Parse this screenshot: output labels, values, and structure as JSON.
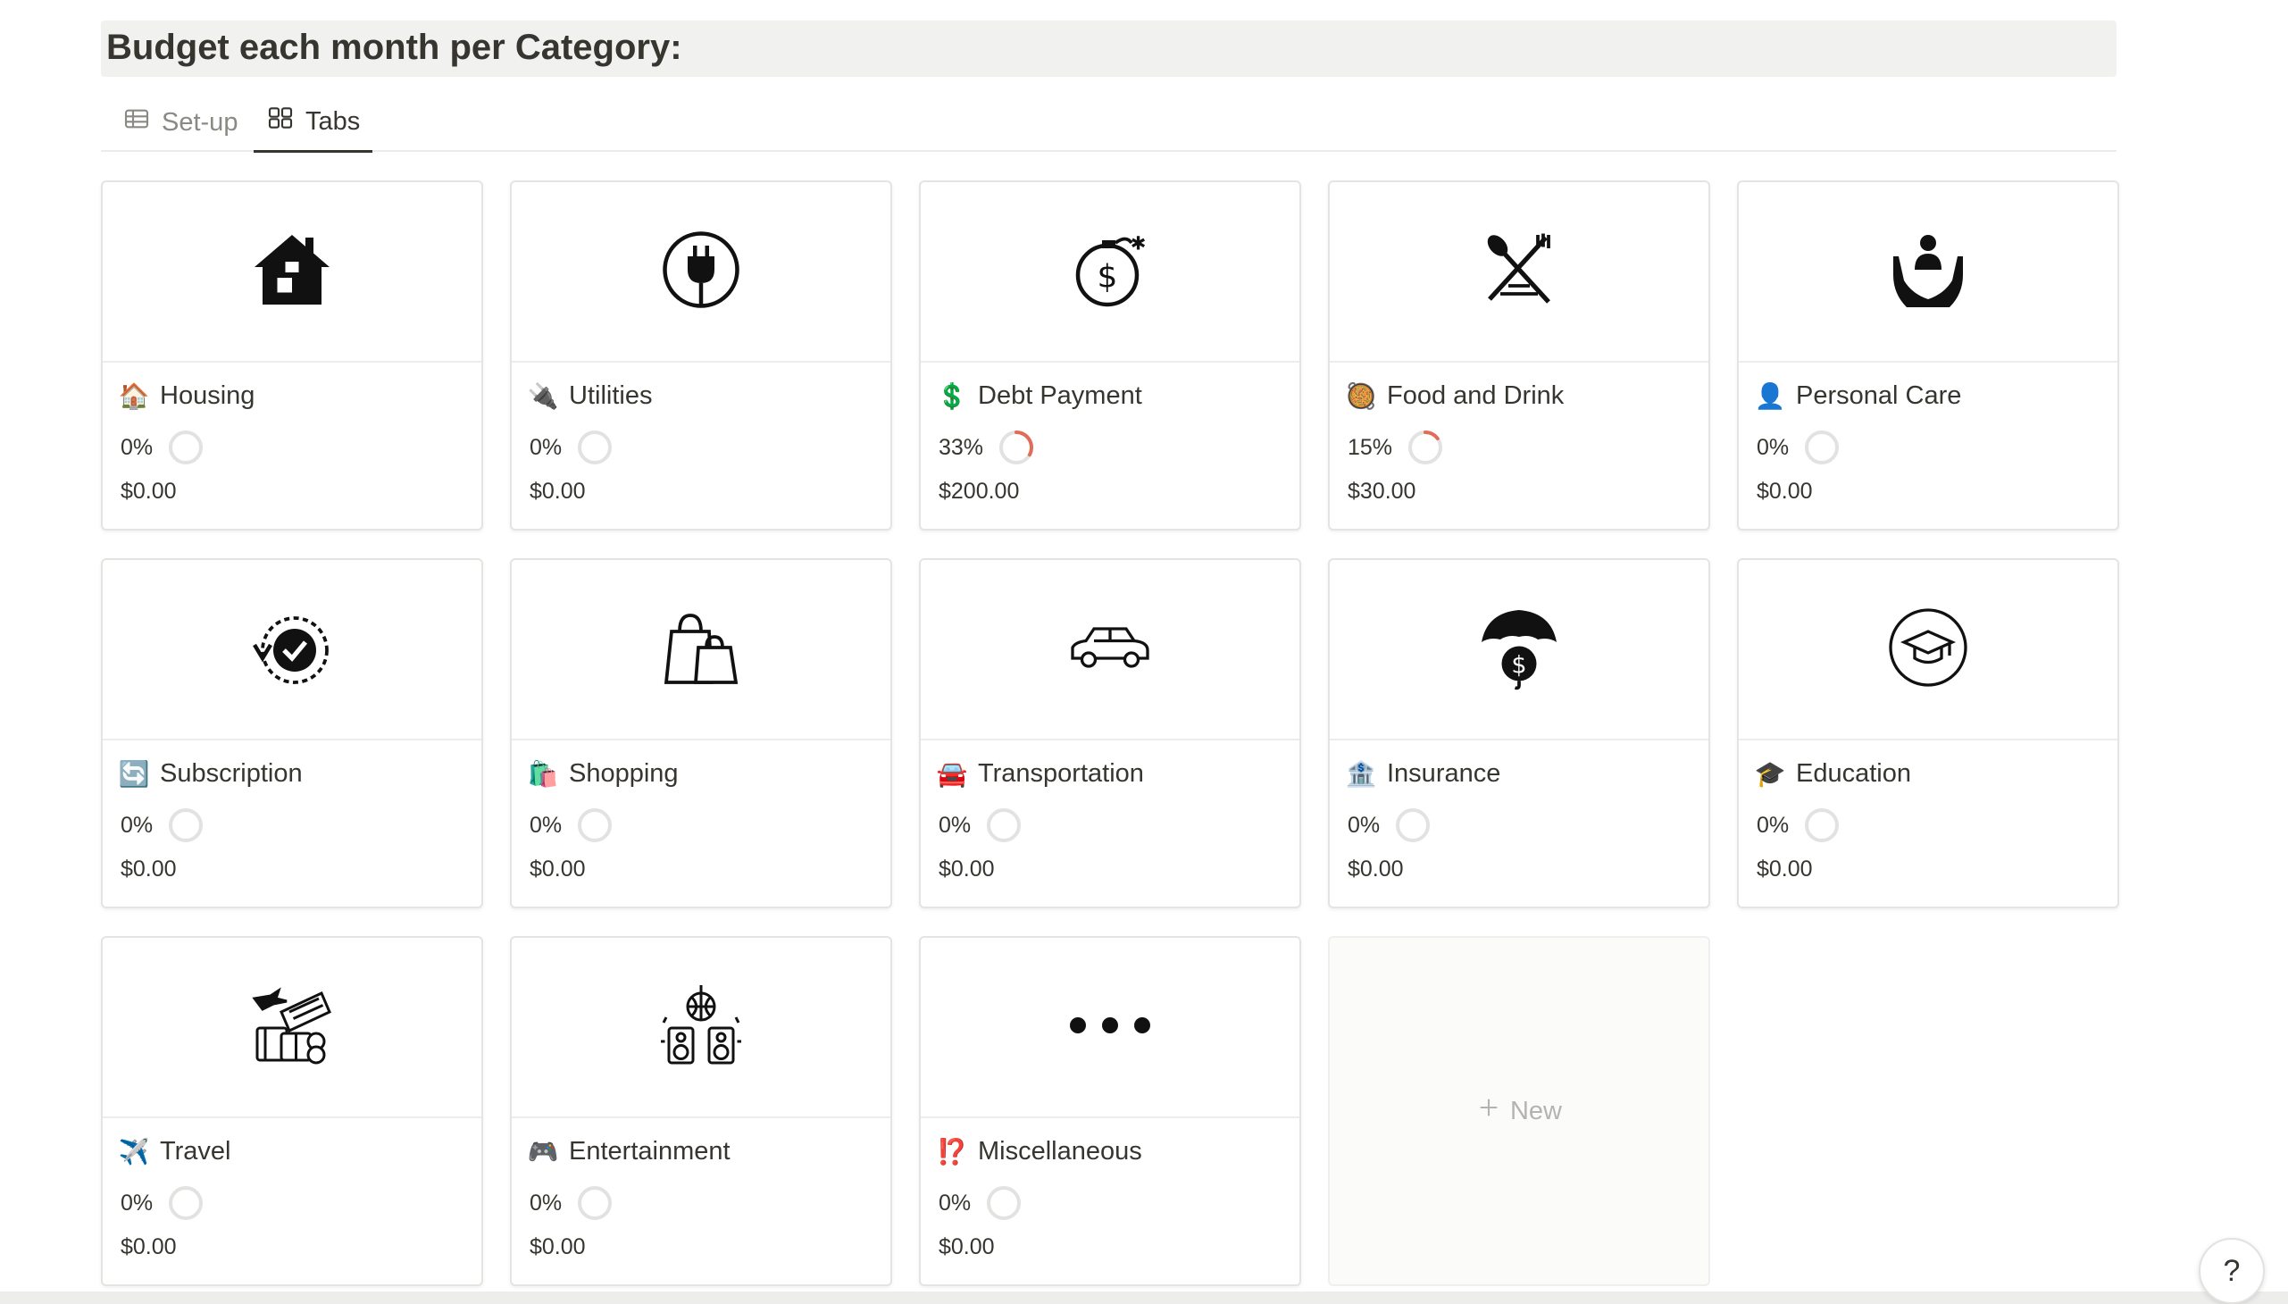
{
  "header": {
    "title": "Budget each month per Category:"
  },
  "tabs": [
    {
      "label": "Set-up",
      "icon": "table-icon",
      "active": false
    },
    {
      "label": "Tabs",
      "icon": "gallery-icon",
      "active": true
    }
  ],
  "cards": [
    {
      "name": "Housing",
      "cover_icon": "house-icon",
      "emoji": "🏠",
      "percent": "0%",
      "progress": 0,
      "amount": "$0.00"
    },
    {
      "name": "Utilities",
      "cover_icon": "plug-icon",
      "emoji": "🔌",
      "percent": "0%",
      "progress": 0,
      "amount": "$0.00"
    },
    {
      "name": "Debt Payment",
      "cover_icon": "money-bomb-icon",
      "emoji": "💲",
      "percent": "33%",
      "progress": 0.33,
      "amount": "$200.00"
    },
    {
      "name": "Food and Drink",
      "cover_icon": "fork-spoon-icon",
      "emoji": "🥘",
      "percent": "15%",
      "progress": 0.15,
      "amount": "$30.00"
    },
    {
      "name": "Personal Care",
      "cover_icon": "hands-care-icon",
      "emoji": "👤",
      "percent": "0%",
      "progress": 0,
      "amount": "$0.00"
    },
    {
      "name": "Subscription",
      "cover_icon": "clock-renew-icon",
      "emoji": "🔄",
      "percent": "0%",
      "progress": 0,
      "amount": "$0.00"
    },
    {
      "name": "Shopping",
      "cover_icon": "shopping-bags-icon",
      "emoji": "🛍️",
      "percent": "0%",
      "progress": 0,
      "amount": "$0.00"
    },
    {
      "name": "Transportation",
      "cover_icon": "car-icon",
      "emoji": "🚘",
      "percent": "0%",
      "progress": 0,
      "amount": "$0.00"
    },
    {
      "name": "Insurance",
      "cover_icon": "umbrella-dollar-icon",
      "emoji": "🏦",
      "percent": "0%",
      "progress": 0,
      "amount": "$0.00"
    },
    {
      "name": "Education",
      "cover_icon": "graduation-cap-icon",
      "emoji": "🎓",
      "percent": "0%",
      "progress": 0,
      "amount": "$0.00"
    },
    {
      "name": "Travel",
      "cover_icon": "travel-luggage-icon",
      "emoji": "✈️",
      "percent": "0%",
      "progress": 0,
      "amount": "$0.00"
    },
    {
      "name": "Entertainment",
      "cover_icon": "disco-speakers-icon",
      "emoji": "🎮",
      "percent": "0%",
      "progress": 0,
      "amount": "$0.00"
    },
    {
      "name": "Miscellaneous",
      "cover_icon": "ellipsis-icon",
      "emoji": "⁉️",
      "percent": "0%",
      "progress": 0,
      "amount": "$0.00"
    }
  ],
  "new_button": {
    "label": "New"
  },
  "help": {
    "label": "?"
  },
  "colors": {
    "progress": "#e06c5a",
    "ring_track": "#e3e2e0",
    "text": "#37352f"
  }
}
